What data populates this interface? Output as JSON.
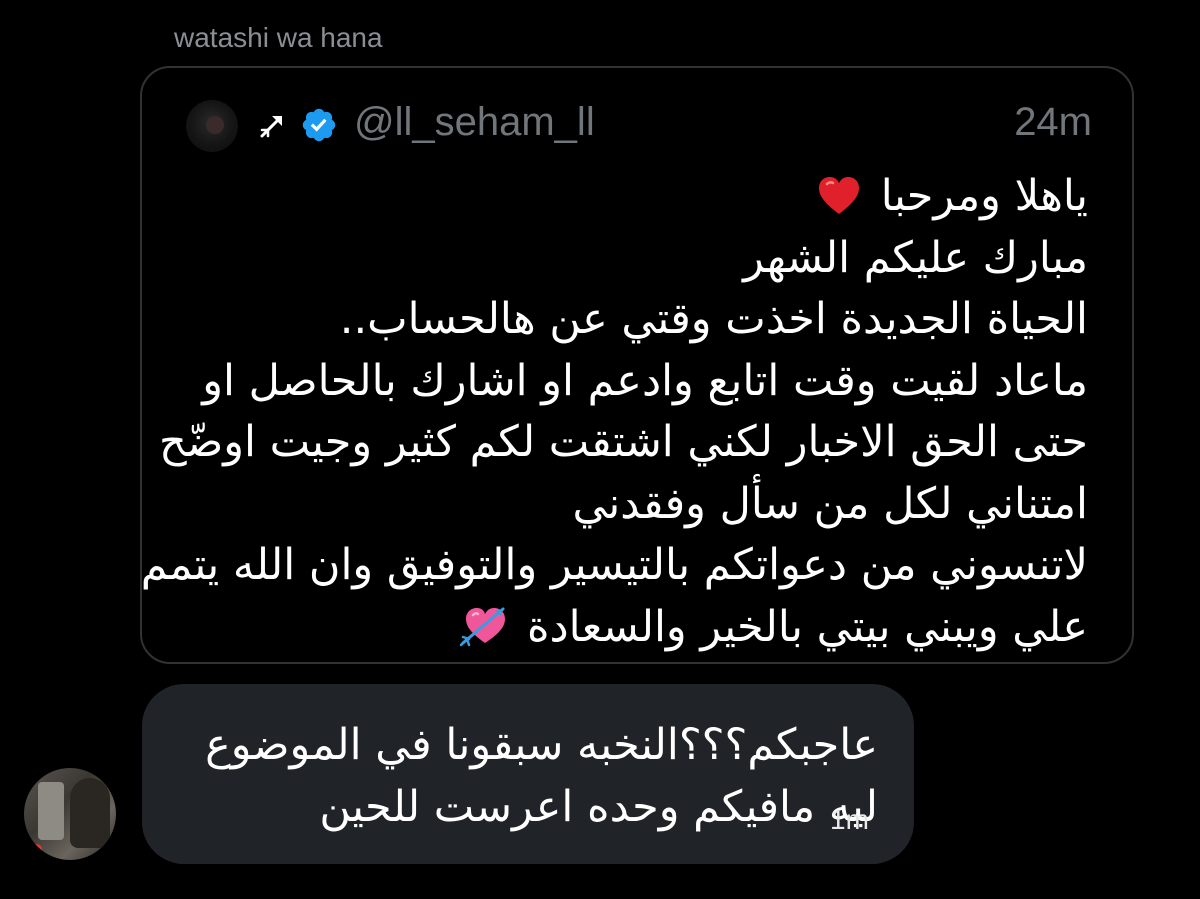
{
  "conversation": {
    "sender_label": "watashi wa hana"
  },
  "quoted_tweet": {
    "handle": "@ll_seham_ll",
    "time": "24m",
    "lines": [
      "ياهلا ومرحبا",
      "مبارك عليكم الشهر",
      "الحياة الجديدة اخذت وقتي عن هالحساب..",
      "ماعاد لقيت وقت اتابع وادعم او اشارك بالحاصل او",
      "حتى الحق الاخبار لكني اشتقت لكم كثير وجيت اوضّح",
      "امتناني لكل من سأل وفقدني",
      "لاتنسوني من دعواتكم بالتيسير والتوفيق وان الله يتمم",
      "علي ويبني بيتي بالخير والسعادة"
    ],
    "icons": {
      "line1_end": "red-heart-emoji",
      "last_line_end": "heart-with-arrow-emoji",
      "pre_handle": "arrow-badge-icon",
      "verified": "verified-badge-icon"
    }
  },
  "reply": {
    "lines": [
      "عاجبكم؟؟؟النخبه سبقونا في الموضوع",
      "ليه مافيكم وحده اعرست للحين"
    ],
    "time": "1m"
  },
  "colors": {
    "background": "#000000",
    "bubble": "#202327",
    "verified": "#1d9bf0",
    "muted_text": "#71767b"
  }
}
